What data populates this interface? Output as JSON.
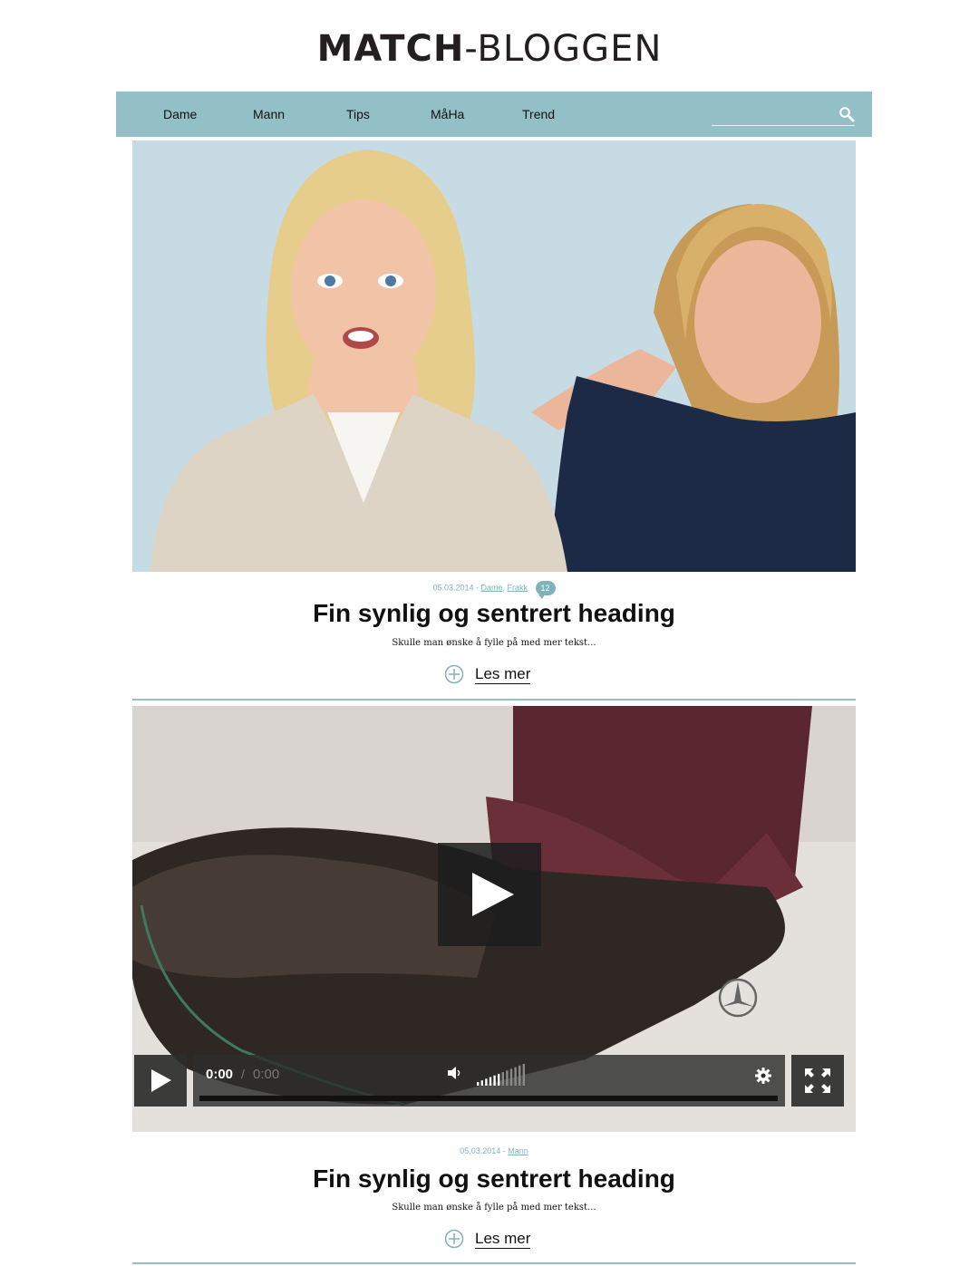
{
  "header": {
    "logo_bold": "MATCH",
    "logo_light": "-BLOGGEN"
  },
  "nav": {
    "items": [
      {
        "label": "Dame"
      },
      {
        "label": "Mann"
      },
      {
        "label": "Tips"
      },
      {
        "label": "MåHa"
      },
      {
        "label": "Trend"
      }
    ],
    "search": {
      "placeholder": "",
      "icon": "search-icon"
    }
  },
  "posts": [
    {
      "date": "05.03.2014",
      "separator": "-",
      "categories": [
        "Dame",
        "Frakk"
      ],
      "comments": "12",
      "title": "Fin synlig og sentrert heading",
      "excerpt": "Skulle man ønske å fylle på med mer tekst...",
      "read_more": "Les mer",
      "media": "image"
    },
    {
      "date": "05.03.2014",
      "separator": "-",
      "categories": [
        "Mann"
      ],
      "title": "Fin synlig og sentrert heading",
      "excerpt": "Skulle man ønske å fylle på med mer tekst...",
      "read_more": "Les mer",
      "media": "video",
      "video": {
        "current_time": "0:00",
        "time_separator": "/",
        "duration": "0:00",
        "volume_level": 0.5
      }
    }
  ],
  "colors": {
    "accent": "#93c0c7",
    "meta_text": "#7fb2ba",
    "text": "#111111"
  }
}
